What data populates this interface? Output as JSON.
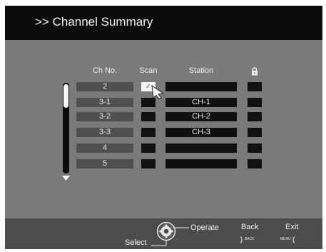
{
  "header": {
    "title": ">> Channel Summary"
  },
  "table": {
    "columns": {
      "ch_no": "Ch No.",
      "scan": "Scan",
      "station": "Station"
    },
    "rows": [
      {
        "ch": "2",
        "scan": true,
        "station": ""
      },
      {
        "ch": "3-1",
        "scan": false,
        "station": "CH-1"
      },
      {
        "ch": "3-2",
        "scan": false,
        "station": "CH-2"
      },
      {
        "ch": "3-3",
        "scan": false,
        "station": "CH-3"
      },
      {
        "ch": "4",
        "scan": false,
        "station": ""
      },
      {
        "ch": "5",
        "scan": false,
        "station": ""
      }
    ],
    "check_glyph": "✓"
  },
  "footer": {
    "select": "Select",
    "operate": "Operate",
    "back": "Back",
    "back_key": "BACK",
    "exit": "Exit",
    "exit_key": "MENU"
  },
  "icons": [
    "lock-icon",
    "scroll-down-arrow-icon",
    "pointer-cursor-icon",
    "dpad-remote-icon"
  ]
}
